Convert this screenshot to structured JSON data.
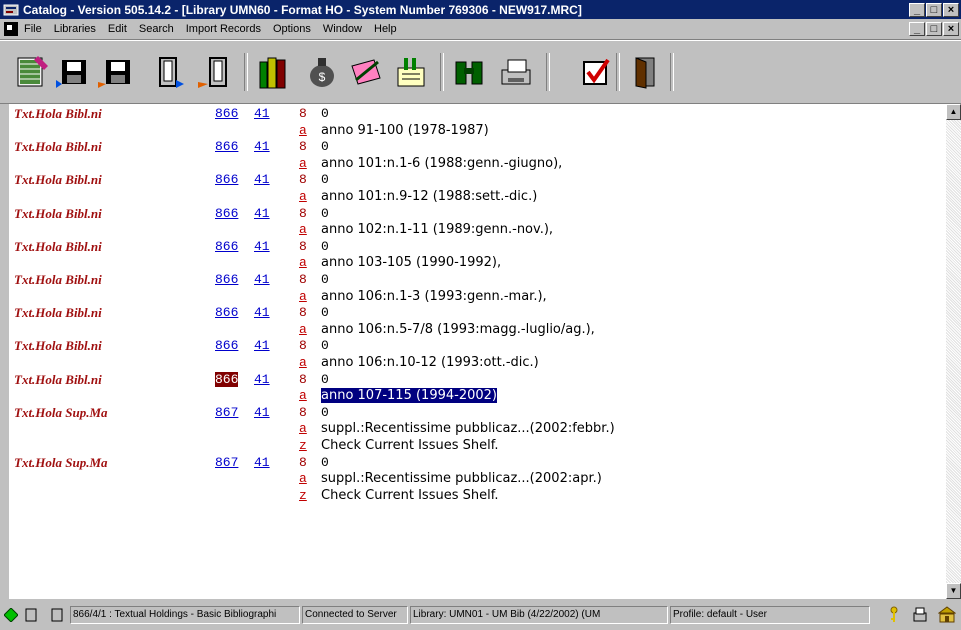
{
  "window": {
    "title": "Catalog - Version 505.14.2 - [Library UMN60 - Format HO - System Number 769306 - NEW917.MRC]",
    "controls": [
      "_",
      "□",
      "×"
    ]
  },
  "menu": {
    "items": [
      "File",
      "Libraries",
      "Edit",
      "Search",
      "Import Records",
      "Options",
      "Window",
      "Help"
    ]
  },
  "toolbar": {
    "icons": [
      "new-record-icon",
      "save-icon",
      "save-server-icon",
      "open-book-icon",
      "open-server-book-icon",
      "books-icon",
      "money-bag-icon",
      "edit-notes-icon",
      "card-catalog-icon",
      "binoculars-icon",
      "printer-icon",
      "check-icon",
      "exit-door-icon"
    ]
  },
  "records": [
    {
      "label": "Txt.Hola Bibl.ni",
      "tag": "866",
      "ind1": "41",
      "ind2": "8",
      "f0": "0",
      "subs": [
        {
          "code": "a",
          "value": "anno 91-100 (1978-1987)"
        }
      ]
    },
    {
      "label": "Txt.Hola Bibl.ni",
      "tag": "866",
      "ind1": "41",
      "ind2": "8",
      "f0": "0",
      "subs": [
        {
          "code": "a",
          "value": "anno 101:n.1-6 (1988:genn.-giugno),"
        }
      ]
    },
    {
      "label": "Txt.Hola Bibl.ni",
      "tag": "866",
      "ind1": "41",
      "ind2": "8",
      "f0": "0",
      "subs": [
        {
          "code": "a",
          "value": "anno 101:n.9-12 (1988:sett.-dic.)"
        }
      ]
    },
    {
      "label": "Txt.Hola Bibl.ni",
      "tag": "866",
      "ind1": "41",
      "ind2": "8",
      "f0": "0",
      "subs": [
        {
          "code": "a",
          "value": "anno 102:n.1-11 (1989:genn.-nov.),"
        }
      ]
    },
    {
      "label": "Txt.Hola Bibl.ni",
      "tag": "866",
      "ind1": "41",
      "ind2": "8",
      "f0": "0",
      "subs": [
        {
          "code": "a",
          "value": "anno 103-105 (1990-1992),"
        }
      ]
    },
    {
      "label": "Txt.Hola Bibl.ni",
      "tag": "866",
      "ind1": "41",
      "ind2": "8",
      "f0": "0",
      "subs": [
        {
          "code": "a",
          "value": "anno 106:n.1-3 (1993:genn.-mar.),"
        }
      ]
    },
    {
      "label": "Txt.Hola Bibl.ni",
      "tag": "866",
      "ind1": "41",
      "ind2": "8",
      "f0": "0",
      "subs": [
        {
          "code": "a",
          "value": "anno 106:n.5-7/8 (1993:magg.-luglio/ag.),"
        }
      ]
    },
    {
      "label": "Txt.Hola Bibl.ni",
      "tag": "866",
      "ind1": "41",
      "ind2": "8",
      "f0": "0",
      "subs": [
        {
          "code": "a",
          "value": "anno 106:n.10-12 (1993:ott.-dic.)"
        }
      ]
    },
    {
      "label": "Txt.Hola Bibl.ni",
      "tag": "866",
      "ind1": "41",
      "ind2": "8",
      "f0": "0",
      "selected": true,
      "subs": [
        {
          "code": "a",
          "value": "anno 107-115 (1994-2002)",
          "highlight": true
        }
      ]
    },
    {
      "label": "Txt.Hola Sup.Ma",
      "tag": "867",
      "ind1": "41",
      "ind2": "8",
      "f0": "0",
      "subs": [
        {
          "code": "a",
          "value": "suppl.:Recentissime pubblicaz...(2002:febbr.)"
        },
        {
          "code": "z",
          "value": "Check Current Issues Shelf."
        }
      ]
    },
    {
      "label": "Txt.Hola Sup.Ma",
      "tag": "867",
      "ind1": "41",
      "ind2": "8",
      "f0": "0",
      "subs": [
        {
          "code": "a",
          "value": "suppl.:Recentissime pubblicaz...(2002:apr.)"
        },
        {
          "code": "z",
          "value": "Check Current Issues Shelf."
        }
      ]
    }
  ],
  "status": {
    "field_info": "866/4/1 : Textual Holdings - Basic Bibliographi",
    "connection": "Connected to Server",
    "library": "Library:  UMN01 - UM Bib (4/22/2002) (UM",
    "profile": "Profile: default - User"
  },
  "colors": {
    "titlebar": "#0a246a",
    "label": "#a01010",
    "link": "#0000cc",
    "selected_tag": "#800000",
    "highlight": "#000080"
  }
}
